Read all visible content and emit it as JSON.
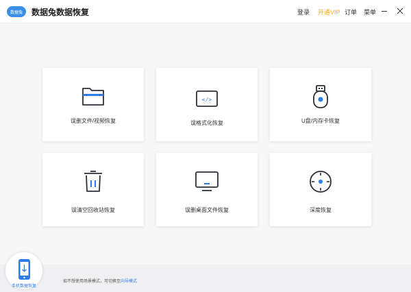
{
  "app": {
    "logo_text": "数据兔",
    "title": "数据兔数据恢复"
  },
  "menu": {
    "login": "登录",
    "vip": "开通VIP",
    "orders": "订单",
    "more": "菜单"
  },
  "cards": [
    {
      "label": "误删文件/视频恢复",
      "icon": "folder-icon"
    },
    {
      "label": "误格式化恢复",
      "icon": "code-window-icon"
    },
    {
      "label": "U盘/内存卡恢复",
      "icon": "usb-drive-icon"
    },
    {
      "label": "误清空回收站恢复",
      "icon": "trash-bin-icon"
    },
    {
      "label": "误删桌面文件恢复",
      "icon": "monitor-icon"
    },
    {
      "label": "深度恢复",
      "icon": "disk-icon"
    }
  ],
  "footer": {
    "phone_label": "手机数据恢复",
    "hint_prefix": "如不想使用场景模式，可切换至",
    "hint_link": "向导模式"
  },
  "colors": {
    "accent": "#2f7ce6",
    "vip": "#f5a623",
    "icon_dark": "#2b2f36"
  }
}
